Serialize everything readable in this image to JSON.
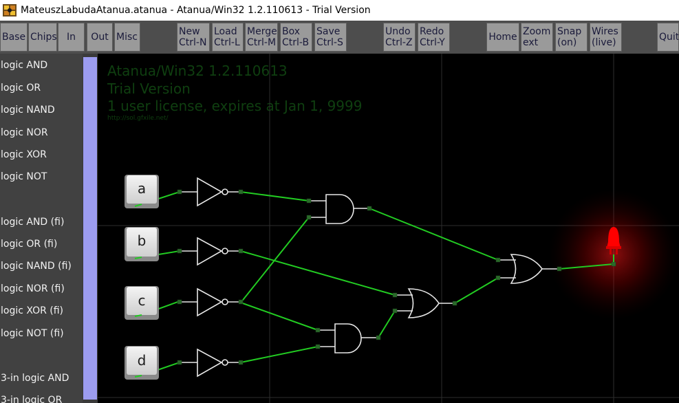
{
  "window": {
    "title": "MateuszLabudaAtanua.atanua - Atanua/Win32 1.2.110613 - Trial Version"
  },
  "toolbar": {
    "base": "Base",
    "chips": "Chips",
    "in": "In",
    "out": "Out",
    "misc": "Misc",
    "new_label": "New",
    "new_shortcut": "Ctrl-N",
    "load_label": "Load",
    "load_shortcut": "Ctrl-L",
    "merge_label": "Merge",
    "merge_shortcut": "Ctrl-M",
    "box_label": "Box",
    "box_shortcut": "Ctrl-B",
    "save_label": "Save",
    "save_shortcut": "Ctrl-S",
    "undo_label": "Undo",
    "undo_shortcut": "Ctrl-Z",
    "redo_label": "Redo",
    "redo_shortcut": "Ctrl-Y",
    "home": "Home",
    "zoom_label": "Zoom",
    "zoom_state": "ext",
    "snap_label": "Snap",
    "snap_state": "(on)",
    "wires_label": "Wires",
    "wires_state": "(live)",
    "quit": "Quit"
  },
  "sidebar": {
    "items": [
      "logic AND",
      "logic OR",
      "logic NAND",
      "logic NOR",
      "logic XOR",
      "logic NOT",
      "logic AND (fi)",
      "logic OR (fi)",
      "logic NAND (fi)",
      "logic NOR (fi)",
      "logic XOR (fi)",
      "logic NOT (fi)",
      "3-in logic AND",
      "3-in logic OR"
    ]
  },
  "canvas": {
    "watermark_line1": "Atanua/Win32 1.2.110613",
    "watermark_line2": "Trial Version",
    "watermark_line3": "1 user license, expires at Jan 1, 9999",
    "watermark_line4": "http://sol.gfxile.net/",
    "keys": [
      "a",
      "b",
      "c",
      "d"
    ],
    "led_label": "LED",
    "led_state": "on"
  },
  "colors": {
    "wire_active": "#22cc22",
    "gate_stroke": "#e8e8e8",
    "pin": "#2a6a2a",
    "led": "#ff0000",
    "sidebar_bg": "#414141",
    "toolbar_bg": "#4d4d4d",
    "button_bg": "#9a9a9a",
    "scroll_thumb": "#9c9cf0",
    "watermark": "#0f3f10"
  },
  "icons": {
    "app": "atanua-app-icon"
  }
}
